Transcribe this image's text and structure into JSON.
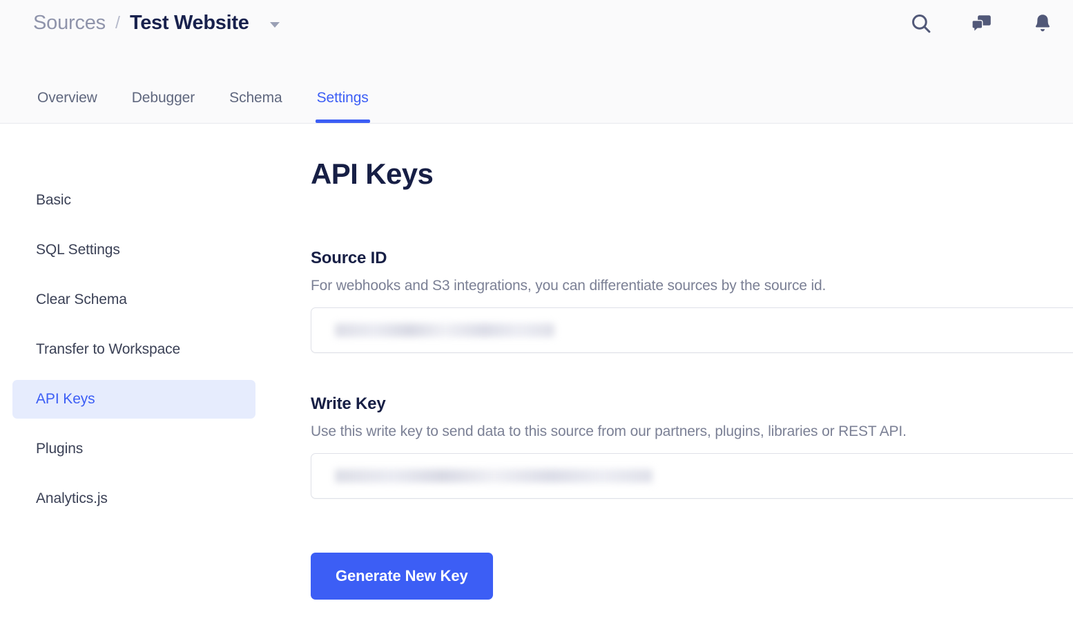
{
  "header": {
    "breadcrumb": {
      "root": "Sources",
      "separator": "/",
      "current": "Test Website",
      "caret_icon": "chevron-down-icon"
    },
    "actions": [
      {
        "name": "search-icon",
        "label": "Search"
      },
      {
        "name": "chat-icon",
        "label": "Messages"
      },
      {
        "name": "bell-icon",
        "label": "Notifications"
      }
    ]
  },
  "tabs": [
    {
      "label": "Overview",
      "active": false
    },
    {
      "label": "Debugger",
      "active": false
    },
    {
      "label": "Schema",
      "active": false
    },
    {
      "label": "Settings",
      "active": true
    }
  ],
  "sidebar": {
    "items": [
      {
        "label": "Basic",
        "active": false
      },
      {
        "label": "SQL Settings",
        "active": false
      },
      {
        "label": "Clear Schema",
        "active": false
      },
      {
        "label": "Transfer to Workspace",
        "active": false
      },
      {
        "label": "API Keys",
        "active": true
      },
      {
        "label": "Plugins",
        "active": false
      },
      {
        "label": "Analytics.js",
        "active": false
      }
    ]
  },
  "main": {
    "title": "API Keys",
    "source_id": {
      "label": "Source ID",
      "help": "For webhooks and S3 integrations, you can differentiate sources by the source id.",
      "value": "",
      "value_state": "redacted"
    },
    "write_key": {
      "label": "Write Key",
      "help": "Use this write key to send data to this source from our partners, plugins, libraries or REST API.",
      "value": "",
      "value_state": "redacted"
    },
    "generate_button": "Generate New Key"
  },
  "colors": {
    "accent": "#3c5ef5",
    "accent_soft": "#e6ecfd",
    "heading": "#171f45",
    "muted_text": "#7b8095",
    "header_bg": "#fafafb",
    "border": "#dfe1e8"
  }
}
